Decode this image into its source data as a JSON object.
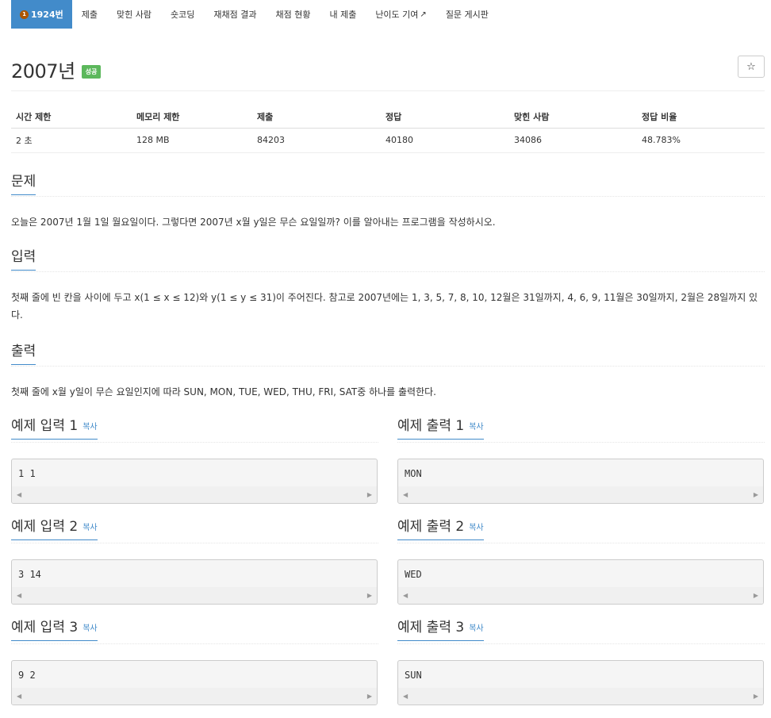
{
  "tabs": {
    "problem_number": "1924번",
    "tier_badge": "1",
    "items": [
      "제출",
      "맞힌 사람",
      "숏코딩",
      "재채점 결과",
      "채점 현황",
      "내 제출",
      "난이도 기여",
      "질문 게시판"
    ]
  },
  "title": "2007년",
  "result_badge": "성공",
  "star_icon": "☆",
  "info": {
    "headers": [
      "시간 제한",
      "메모리 제한",
      "제출",
      "정답",
      "맞힌 사람",
      "정답 비율"
    ],
    "values": [
      "2 초",
      "128 MB",
      "84203",
      "40180",
      "34086",
      "48.783%"
    ]
  },
  "sections": {
    "problem": {
      "heading": "문제",
      "text": "오늘은 2007년 1월 1일 월요일이다. 그렇다면 2007년 x월 y일은 무슨 요일일까? 이를 알아내는 프로그램을 작성하시오."
    },
    "input": {
      "heading": "입력",
      "text": "첫째 줄에 빈 칸을 사이에 두고 x(1 ≤ x ≤ 12)와 y(1 ≤ y ≤ 31)이 주어진다. 참고로 2007년에는 1, 3, 5, 7, 8, 10, 12월은 31일까지, 4, 6, 9, 11월은 30일까지, 2월은 28일까지 있다."
    },
    "output": {
      "heading": "출력",
      "text": "첫째 줄에 x월 y일이 무슨 요일인지에 따라 SUN, MON, TUE, WED, THU, FRI, SAT중 하나를 출력한다."
    }
  },
  "copy_label": "복사",
  "samples": [
    {
      "input_heading": "예제 입력 1",
      "output_heading": "예제 출력 1",
      "input": "1 1",
      "output": "MON"
    },
    {
      "input_heading": "예제 입력 2",
      "output_heading": "예제 출력 2",
      "input": "3 14",
      "output": "WED"
    },
    {
      "input_heading": "예제 입력 3",
      "output_heading": "예제 출력 3",
      "input": "9 2",
      "output": "SUN"
    }
  ],
  "colors": {
    "accent": "#428bca",
    "success": "#5cb85c",
    "tier_bronze": "#ad5600"
  }
}
